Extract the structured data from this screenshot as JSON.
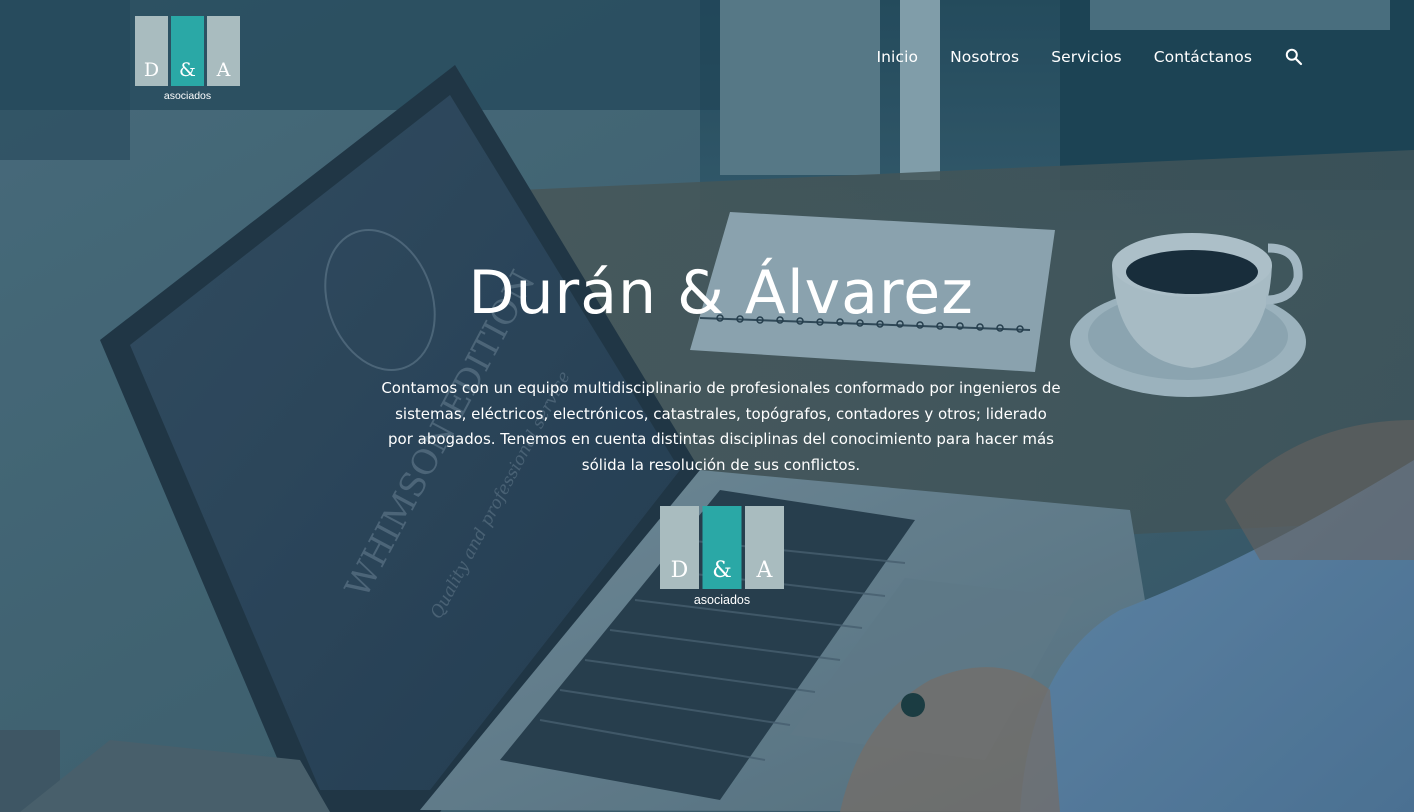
{
  "brand": {
    "letters": [
      "D",
      "&",
      "A"
    ],
    "subtitle": "asociados",
    "tile_color_light": "#a9bcbf",
    "tile_color_accent": "#2aa8a6"
  },
  "nav": {
    "items": [
      {
        "label": "Inicio"
      },
      {
        "label": "Nosotros"
      },
      {
        "label": "Servicios"
      },
      {
        "label": "Contáctanos"
      }
    ],
    "search_icon": "search-icon"
  },
  "hero": {
    "title": "Durán & Álvarez",
    "description": "Contamos con un equipo multidisciplinario de profesionales conformado por ingenieros de sistemas, eléctricos, electrónicos, catastrales, topógrafos, contadores y otros; liderado por abogados.  Tenemos en cuenta distintas disciplinas del conocimiento para hacer más sólida la resolución de sus conflictos."
  }
}
